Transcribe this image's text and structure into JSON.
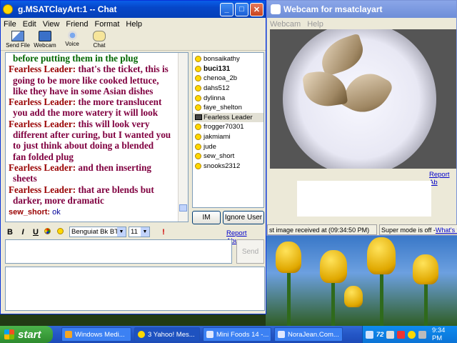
{
  "chat_window": {
    "title": "g.MSATClayArt:1 -- Chat",
    "menu": [
      "File",
      "Edit",
      "View",
      "Friend",
      "Format",
      "Help"
    ],
    "toolbar": [
      {
        "label": "Send File",
        "icon": "send-file-icon"
      },
      {
        "label": "Webcam",
        "icon": "webcam-icon"
      },
      {
        "label": "Voice",
        "icon": "voice-icon"
      },
      {
        "label": "Chat",
        "icon": "chat-icon"
      }
    ],
    "messages": [
      {
        "sender": "",
        "text": "before putting them in the plug",
        "style": "green"
      },
      {
        "sender": "Fearless Leader:",
        "text": " that's the ticket, this is",
        "style": "maroon"
      },
      {
        "sender": "",
        "text": "going to be more like cooked lettuce,",
        "style": "maroon"
      },
      {
        "sender": "",
        "text": "like they have in some Asian dishes",
        "style": "maroon"
      },
      {
        "sender": "Fearless Leader:",
        "text": " the more translucent",
        "style": "maroon"
      },
      {
        "sender": "",
        "text": "you add the more watery it will look",
        "style": "maroon"
      },
      {
        "sender": "Fearless Leader:",
        "text": " this will look very",
        "style": "maroon"
      },
      {
        "sender": "",
        "text": "different after curing, but I wanted you",
        "style": "maroon"
      },
      {
        "sender": "",
        "text": "to just think about doing a blended",
        "style": "maroon"
      },
      {
        "sender": "",
        "text": "fan folded plug",
        "style": "maroon"
      },
      {
        "sender": "Fearless Leader:",
        "text": " and then inserting",
        "style": "maroon"
      },
      {
        "sender": "",
        "text": "sheets",
        "style": "maroon"
      },
      {
        "sender": "Fearless Leader:",
        "text": " that are blends but",
        "style": "maroon"
      },
      {
        "sender": "",
        "text": "darker, more dramatic",
        "style": "maroon"
      },
      {
        "sender": "sew_short:",
        "text": " ok",
        "style": "blue"
      }
    ],
    "users": [
      {
        "name": "bonsaikathy",
        "bold": false,
        "cam": false
      },
      {
        "name": "buci131",
        "bold": true,
        "cam": false
      },
      {
        "name": "chenoa_2b",
        "bold": false,
        "cam": false
      },
      {
        "name": "dahs512",
        "bold": false,
        "cam": false
      },
      {
        "name": "dylinna",
        "bold": false,
        "cam": false
      },
      {
        "name": "faye_shelton",
        "bold": false,
        "cam": false
      },
      {
        "name": "Fearless Leader",
        "bold": false,
        "cam": true
      },
      {
        "name": "frogger70301",
        "bold": false,
        "cam": false
      },
      {
        "name": "jakmiami",
        "bold": false,
        "cam": false
      },
      {
        "name": "jude",
        "bold": false,
        "cam": false
      },
      {
        "name": "sew_short",
        "bold": false,
        "cam": false
      },
      {
        "name": "snooks2312",
        "bold": false,
        "cam": false
      }
    ],
    "im_button": "IM",
    "ignore_button": "Ignore User",
    "format": {
      "bold": "B",
      "italic": "I",
      "underline": "U",
      "font": "Benguiat Bk BT",
      "size": "11"
    },
    "report_abuse": "Report Abuse",
    "send_button": "Send"
  },
  "webcam_window": {
    "title": "Webcam for msatclayart",
    "menu": [
      "Webcam",
      "Help"
    ],
    "report_abuse": "Report Ab",
    "status_left": "st image received at (09:34:50 PM)",
    "status_right": "Super mode is off - ",
    "status_link": "What's th"
  },
  "taskbar": {
    "start": "start",
    "tasks": [
      "Windows Medi...",
      "3 Yahoo! Mes...",
      "Mini Foods 14 -...",
      "NoraJean.Com..."
    ],
    "tray_number": "72",
    "clock": "9:34 PM"
  },
  "colors": {
    "title_active": "#0646c8",
    "sender": "#990000",
    "message": "#800040",
    "green_text": "#006600",
    "blue_text": "#000099"
  }
}
